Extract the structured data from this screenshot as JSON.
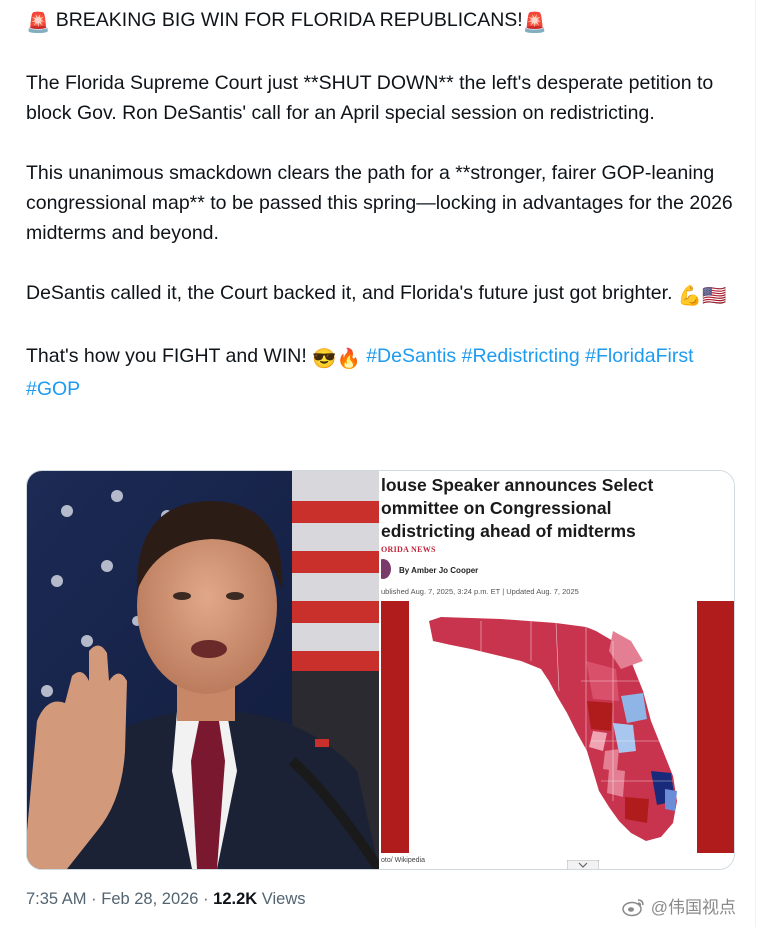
{
  "tweet": {
    "headline_emoji_left": "🚨",
    "headline": "BREAKING BIG WIN FOR FLORIDA REPUBLICANS!",
    "headline_emoji_right": "🚨",
    "para1": "The Florida Supreme Court just **SHUT DOWN** the left's desperate petition to block Gov. Ron DeSantis' call for an April special session on redistricting.",
    "para2": "This unanimous smackdown clears the path for a **stronger, fairer GOP-leaning congressional map** to be passed this spring—locking in advantages for the 2026 midterms and beyond.",
    "para3": "DeSantis called it, the Court backed it, and Florida's future just got brighter.",
    "para3_emojis": "💪🇺🇸",
    "para4": "That's how you FIGHT and WIN!",
    "para4_emojis": "😎🔥",
    "hashtags": [
      "#DeSantis",
      "#Redistricting",
      "#FloridaFirst",
      "#GOP"
    ]
  },
  "media": {
    "article": {
      "headline_lines": [
        "louse Speaker announces Select",
        "ommittee on Congressional",
        "edistricting ahead of midterms"
      ],
      "section": "ORIDA NEWS",
      "byline": "By Amber Jo Cooper",
      "published": "ublished Aug. 7, 2025, 3:24 p.m. ET | Updated Aug. 7, 2025",
      "photo_credit": "oto/ Wikipedia"
    }
  },
  "meta": {
    "time": "7:35 AM",
    "sep1": "·",
    "date": "Feb 28, 2026",
    "sep2": "·",
    "views_count": "12.2K",
    "views_label": "Views"
  },
  "watermark": {
    "icon": "weibo-icon",
    "text": "@伟国视点"
  },
  "colors": {
    "hashtag": "#1d9bf0",
    "text": "#0f1419",
    "muted": "#536471",
    "map_red": "#c8344e",
    "map_frame": "#b01c1c"
  }
}
